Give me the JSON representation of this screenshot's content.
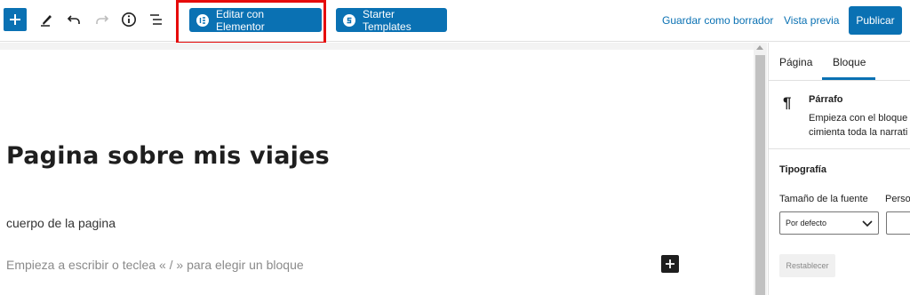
{
  "toolbar": {
    "elementor_label": "Editar con Elementor",
    "starter_label": "Starter Templates",
    "save_draft_label": "Guardar como borrador",
    "preview_label": "Vista previa",
    "publish_label": "Publicar",
    "icons": [
      "plus-icon",
      "pencil-icon",
      "undo-icon",
      "redo-icon",
      "info-icon",
      "list-view-icon"
    ]
  },
  "canvas": {
    "title": "Pagina sobre mis viajes",
    "paragraph": "cuerpo de la pagina",
    "placeholder": "Empieza a escribir o teclea « / » para elegir un bloque"
  },
  "sidebar": {
    "tabs": [
      {
        "label": "Página"
      },
      {
        "label": "Bloque"
      }
    ],
    "block": {
      "name": "Párrafo",
      "description_line1": "Empieza con el bloque",
      "description_line2": "cimienta toda la narrati"
    },
    "typography": {
      "heading": "Tipografía",
      "font_size_label": "Tamaño de la fuente",
      "custom_label": "Perso",
      "select_value": "Por defecto",
      "reset_label": "Restablecer"
    }
  },
  "colors": {
    "accent": "#0a71b3",
    "highlight": "#e60b0b"
  }
}
